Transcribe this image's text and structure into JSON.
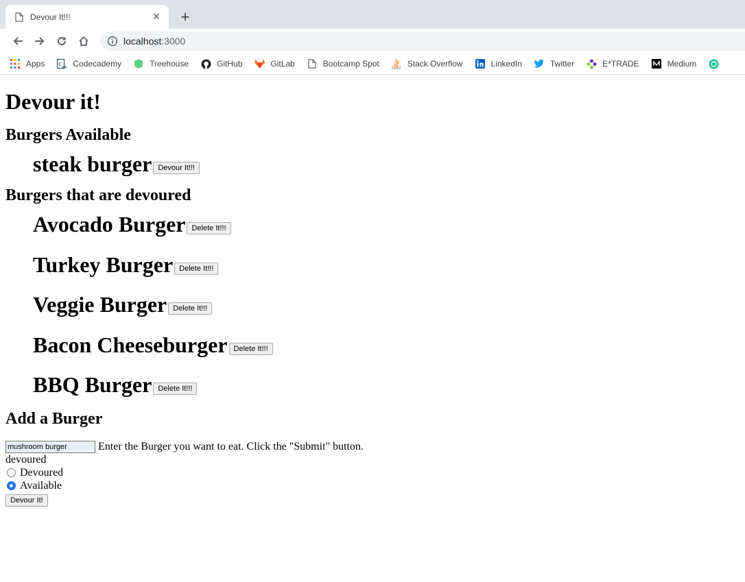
{
  "browser": {
    "tab_title": "Devour It!!!",
    "close_glyph": "✕",
    "newtab_glyph": "+",
    "url_host": "localhost",
    "url_port": ":3000",
    "bookmarks": [
      {
        "label": "Apps",
        "icon": "apps-grid-icon",
        "color": "#ea4335"
      },
      {
        "label": "Codecademy",
        "icon": "codecademy-icon",
        "color": "#1f4056"
      },
      {
        "label": "Treehouse",
        "icon": "treehouse-icon",
        "color": "#5fcf80"
      },
      {
        "label": "GitHub",
        "icon": "github-icon",
        "color": "#24292e"
      },
      {
        "label": "GitLab",
        "icon": "gitlab-icon",
        "color": "#fc6d26"
      },
      {
        "label": "Bootcamp Spot",
        "icon": "page-icon",
        "color": "#5f6368"
      },
      {
        "label": "Stack Overflow",
        "icon": "stackoverflow-icon",
        "color": "#f48024"
      },
      {
        "label": "LinkedIn",
        "icon": "linkedin-icon",
        "color": "#0a66c2"
      },
      {
        "label": "Twitter",
        "icon": "twitter-icon",
        "color": "#1da1f2"
      },
      {
        "label": "E*TRADE",
        "icon": "etrade-icon",
        "color": "#6633cc"
      },
      {
        "label": "Medium",
        "icon": "medium-icon",
        "color": "#000000"
      }
    ]
  },
  "page": {
    "title": "Devour it!",
    "available_heading": "Burgers Available",
    "available": [
      {
        "name": "steak burger",
        "button": "Devour It!!!"
      }
    ],
    "devoured_heading": "Burgers that are devoured",
    "devoured": [
      {
        "name": "Avocado Burger",
        "button": "Delete It!!!"
      },
      {
        "name": "Turkey Burger",
        "button": "Delete It!!!"
      },
      {
        "name": "Veggie Burger",
        "button": "Delete It!!!"
      },
      {
        "name": "Bacon Cheeseburger",
        "button": "Delete It!!!"
      },
      {
        "name": "BBQ Burger",
        "button": "Delete It!!!"
      }
    ],
    "add_heading": "Add a Burger",
    "form": {
      "input_value": "mushroom burger",
      "instructions": "Enter the Burger you want to eat. Click the \"Submit\" button.",
      "radio_group_label": "devoured",
      "options": [
        {
          "label": "Devoured",
          "checked": false
        },
        {
          "label": "Available",
          "checked": true
        }
      ],
      "submit_label": "Devour It!"
    }
  }
}
